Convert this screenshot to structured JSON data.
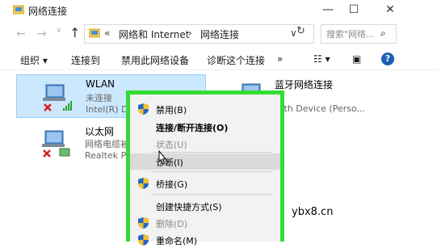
{
  "window": {
    "title": "网络连接",
    "minimize_glyph": "—",
    "maximize_glyph": "☐",
    "close_glyph": "✕"
  },
  "address": {
    "back_glyph": "←",
    "forward_glyph": "→",
    "recent_glyph": "∨",
    "up_glyph": "↑",
    "overflow": "«",
    "crumbs": [
      "网络和 Internet",
      "网络连接"
    ],
    "separator": "›",
    "dropdown_glyph": "∨",
    "refresh_glyph": "↻",
    "search_placeholder": "搜索\"网络...",
    "search_icon": "⌕"
  },
  "toolbar": {
    "organize": "组织 ▾",
    "connect_to": "连接到",
    "disable_device": "禁用此网络设备",
    "diagnose": "诊断这个连接",
    "more": "»",
    "view_glyph": "☷ ▾",
    "preview_glyph": "▣",
    "help_glyph": "?"
  },
  "connections": [
    {
      "name": "WLAN",
      "status": "未连接",
      "device": "Intel(R) D",
      "selected": true,
      "icon": "wifi-adapter-icon"
    },
    {
      "name": "以太网",
      "status": "网络电缆被...",
      "device": "Realtek P",
      "selected": false,
      "icon": "ethernet-adapter-icon"
    },
    {
      "name": "蓝牙网络连接",
      "status": "",
      "device": "uetooth Device (Perso...",
      "selected": false,
      "icon": "bluetooth-adapter-icon"
    }
  ],
  "context_menu": {
    "items": [
      {
        "label": "禁用(B)",
        "icon": "shield-icon",
        "bold": false,
        "disabled": false
      },
      {
        "label": "连接/断开连接(O)",
        "icon": "",
        "bold": true,
        "disabled": false
      },
      {
        "label": "状态(U)",
        "icon": "",
        "bold": false,
        "disabled": true
      },
      {
        "label": "诊断(I)",
        "icon": "",
        "bold": false,
        "disabled": false,
        "hover": true
      },
      {
        "label": "桥接(G)",
        "icon": "shield-icon",
        "bold": false,
        "disabled": false
      },
      {
        "label": "创建快捷方式(S)",
        "icon": "",
        "bold": false,
        "disabled": false
      },
      {
        "label": "删除(D)",
        "icon": "shield-icon",
        "bold": false,
        "disabled": true
      },
      {
        "label": "重命名(M)",
        "icon": "shield-icon",
        "bold": false,
        "disabled": false
      }
    ],
    "highlight_color": "#33dd33"
  },
  "watermark": "ybx8.cn"
}
